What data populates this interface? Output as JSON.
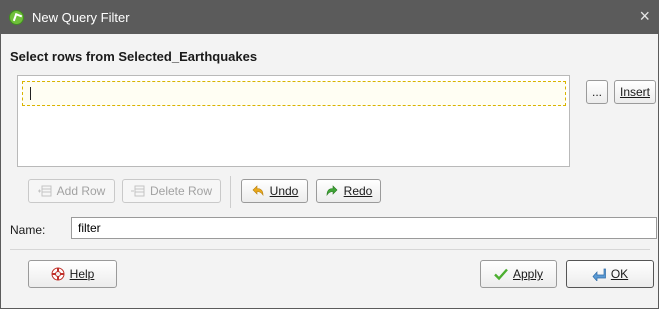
{
  "window": {
    "title": "New Query Filter",
    "close_glyph": "×"
  },
  "heading": "Select rows from Selected_Earthquakes",
  "editor": {
    "expression": ""
  },
  "side_buttons": {
    "ellipsis_label": "...",
    "insert_label": "Insert"
  },
  "toolbar": {
    "add_row_label": "Add Row",
    "delete_row_label": "Delete Row",
    "undo_label": "Undo",
    "redo_label": "Redo"
  },
  "name_field": {
    "label": "Name:",
    "value": "filter"
  },
  "footer": {
    "help_label": "Help",
    "apply_label": "Apply",
    "ok_label": "OK"
  },
  "icons": {
    "app": "leapfrog-logo-icon",
    "add_row": "add-row-icon",
    "delete_row": "delete-row-icon",
    "undo": "undo-arrow-icon",
    "redo": "redo-arrow-icon",
    "help": "lifebuoy-icon",
    "apply": "checkmark-icon",
    "ok": "enter-arrow-icon"
  },
  "colors": {
    "titlebar": "#5b5b5b",
    "dialog_bg": "#f3f3f3",
    "editor_dashed_border": "#d9b400",
    "undo_icon": "#e8a81a",
    "redo_icon": "#3fa535"
  }
}
